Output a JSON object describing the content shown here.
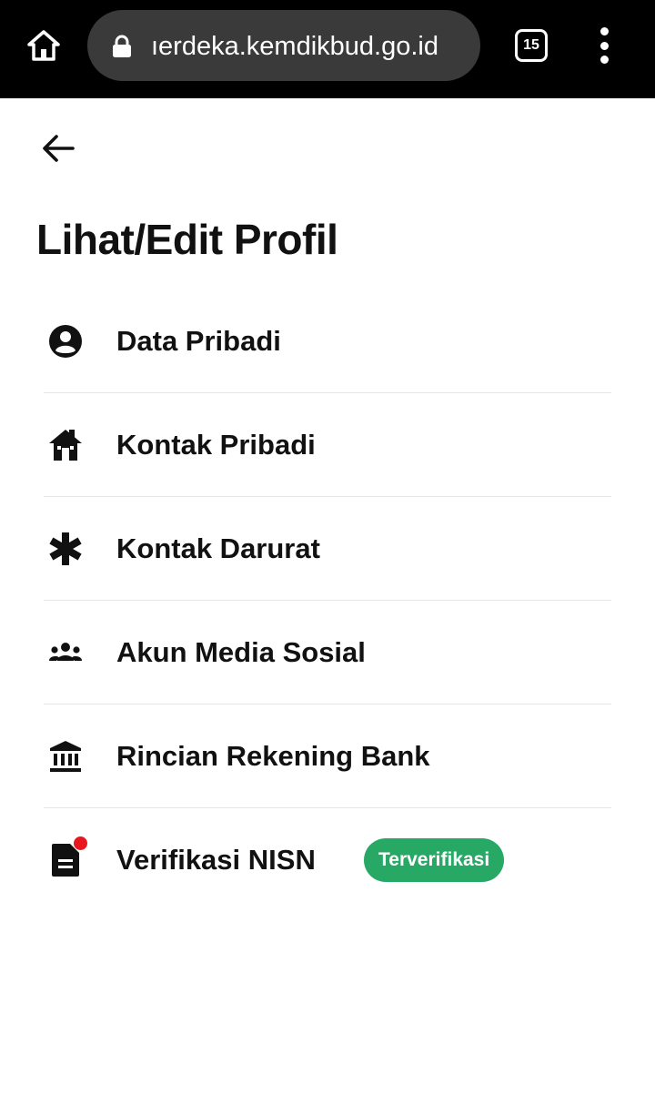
{
  "browser": {
    "url": "ıerdeka.kemdikbud.go.id",
    "tab_count": "15"
  },
  "page": {
    "title": "Lihat/Edit Profil"
  },
  "menu": [
    {
      "label": "Data Pribadi",
      "icon": "account-circle-icon"
    },
    {
      "label": "Kontak Pribadi",
      "icon": "home-icon"
    },
    {
      "label": "Kontak Darurat",
      "icon": "asterisk-icon"
    },
    {
      "label": "Akun Media Sosial",
      "icon": "people-group-icon"
    },
    {
      "label": "Rincian Rekening Bank",
      "icon": "bank-icon"
    },
    {
      "label": "Verifikasi NISN",
      "icon": "document-icon",
      "badge": "Terverifikasi"
    }
  ],
  "colors": {
    "badge_green": "#27a865",
    "notification_red": "#e8171f",
    "browser_bar": "#000000"
  }
}
